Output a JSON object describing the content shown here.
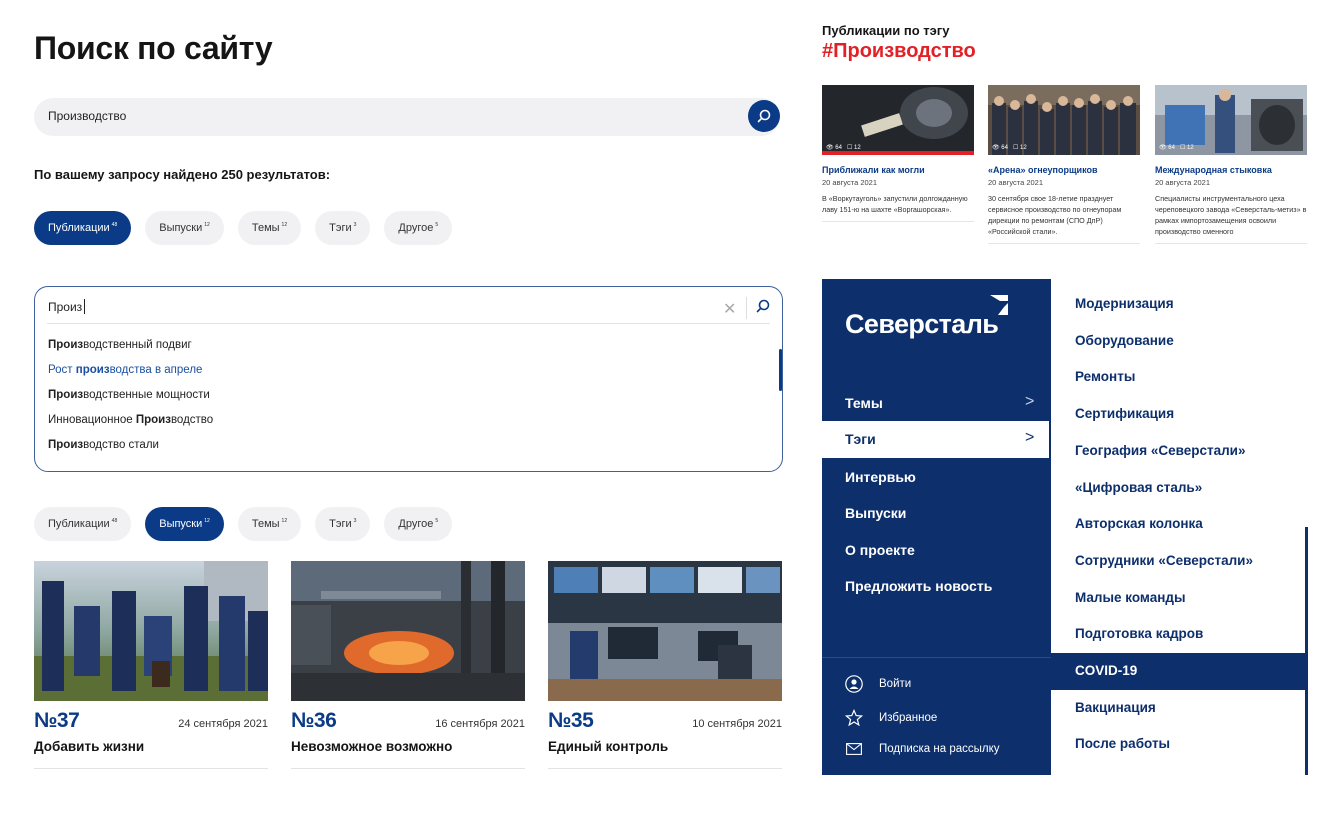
{
  "search": {
    "title": "Поиск по сайту",
    "query": "Производство",
    "results_text": "По вашему запросу найдено 250 результатов:"
  },
  "filters_top": [
    {
      "label": "Публикации",
      "count": "48",
      "active": true
    },
    {
      "label": "Выпуски",
      "count": "12",
      "active": false
    },
    {
      "label": "Темы",
      "count": "12",
      "active": false
    },
    {
      "label": "Тэги",
      "count": "3",
      "active": false
    },
    {
      "label": "Другое",
      "count": "5",
      "active": false
    }
  ],
  "autocomplete": {
    "input": "Произ",
    "suggestions": [
      {
        "parts": [
          {
            "b": "Произ"
          },
          {
            "t": "водственный подвиг"
          }
        ]
      },
      {
        "parts": [
          {
            "t": "Рост "
          },
          {
            "b": "произ"
          },
          {
            "t": "водства в апреле"
          }
        ],
        "highlight": true
      },
      {
        "parts": [
          {
            "b": "Произ"
          },
          {
            "t": "водственные мощности"
          }
        ]
      },
      {
        "parts": [
          {
            "t": "Инновационное "
          },
          {
            "b": "Произ"
          },
          {
            "t": "водство"
          }
        ]
      },
      {
        "parts": [
          {
            "b": "Произ"
          },
          {
            "t": "водство стали"
          }
        ]
      }
    ]
  },
  "filters_bottom": [
    {
      "label": "Публикации",
      "count": "48",
      "active": false
    },
    {
      "label": "Выпуски",
      "count": "12",
      "active": true
    },
    {
      "label": "Темы",
      "count": "12",
      "active": false
    },
    {
      "label": "Тэги",
      "count": "3",
      "active": false
    },
    {
      "label": "Другое",
      "count": "5",
      "active": false
    }
  ],
  "issues": [
    {
      "number": "№37",
      "date": "24 сентября 2021",
      "title": "Добавить жизни"
    },
    {
      "number": "№36",
      "date": "16 сентября 2021",
      "title": "Невозможное возможно"
    },
    {
      "number": "№35",
      "date": "10 сентября 2021",
      "title": "Единый контроль"
    }
  ],
  "tag_publications": {
    "label": "Публикации по тэгу",
    "tag": "#Производство",
    "items": [
      {
        "views": "64",
        "comments": "12",
        "title": "Приближали как могли",
        "date": "20 августа 2021",
        "desc": "В «Воркутауголь» запустили долгожданную лаву 151-ю на шахте «Воргашорская»."
      },
      {
        "views": "64",
        "comments": "12",
        "title": "«Арена» огнеупорщиков",
        "date": "20 августа 2021",
        "desc": "30 сентября свое 18-летие празднует сервисное производство по огнеупорам дирекции по ремонтам (СПО ДпР) «Российской стали»."
      },
      {
        "views": "64",
        "comments": "12",
        "title": "Международная стыковка",
        "date": "20 августа 2021",
        "desc": "Специалисты инструментального цеха череповецкого завода «Северсталь-метиз» в рамках импортозамещения освоили производство сменного"
      }
    ]
  },
  "menu": {
    "logo": "Северсталь",
    "items": [
      "Темы",
      "Тэги",
      "Интервью",
      "Выпуски",
      "О проекте",
      "Предложить новость"
    ],
    "active_item": "Тэги",
    "utils": [
      {
        "icon": "user-icon",
        "label": "Войти"
      },
      {
        "icon": "star-icon",
        "label": "Избранное"
      },
      {
        "icon": "mail-icon",
        "label": "Подписка на рассылку"
      }
    ]
  },
  "tags": {
    "items": [
      "Модернизация",
      "Оборудование",
      "Ремонты",
      "Сертификация",
      "География «Северстали»",
      "«Цифровая сталь»",
      "Авторская колонка",
      "Сотрудники «Северстали»",
      "Малые команды",
      "Подготовка кадров",
      "COVID-19",
      "Вакцинация",
      "После работы"
    ],
    "active": "COVID-19"
  },
  "colors": {
    "brand_blue": "#0b3b86",
    "nav_blue": "#0d2f6c",
    "tag_red": "#e32026",
    "chip_bg": "#f1f1f3"
  }
}
